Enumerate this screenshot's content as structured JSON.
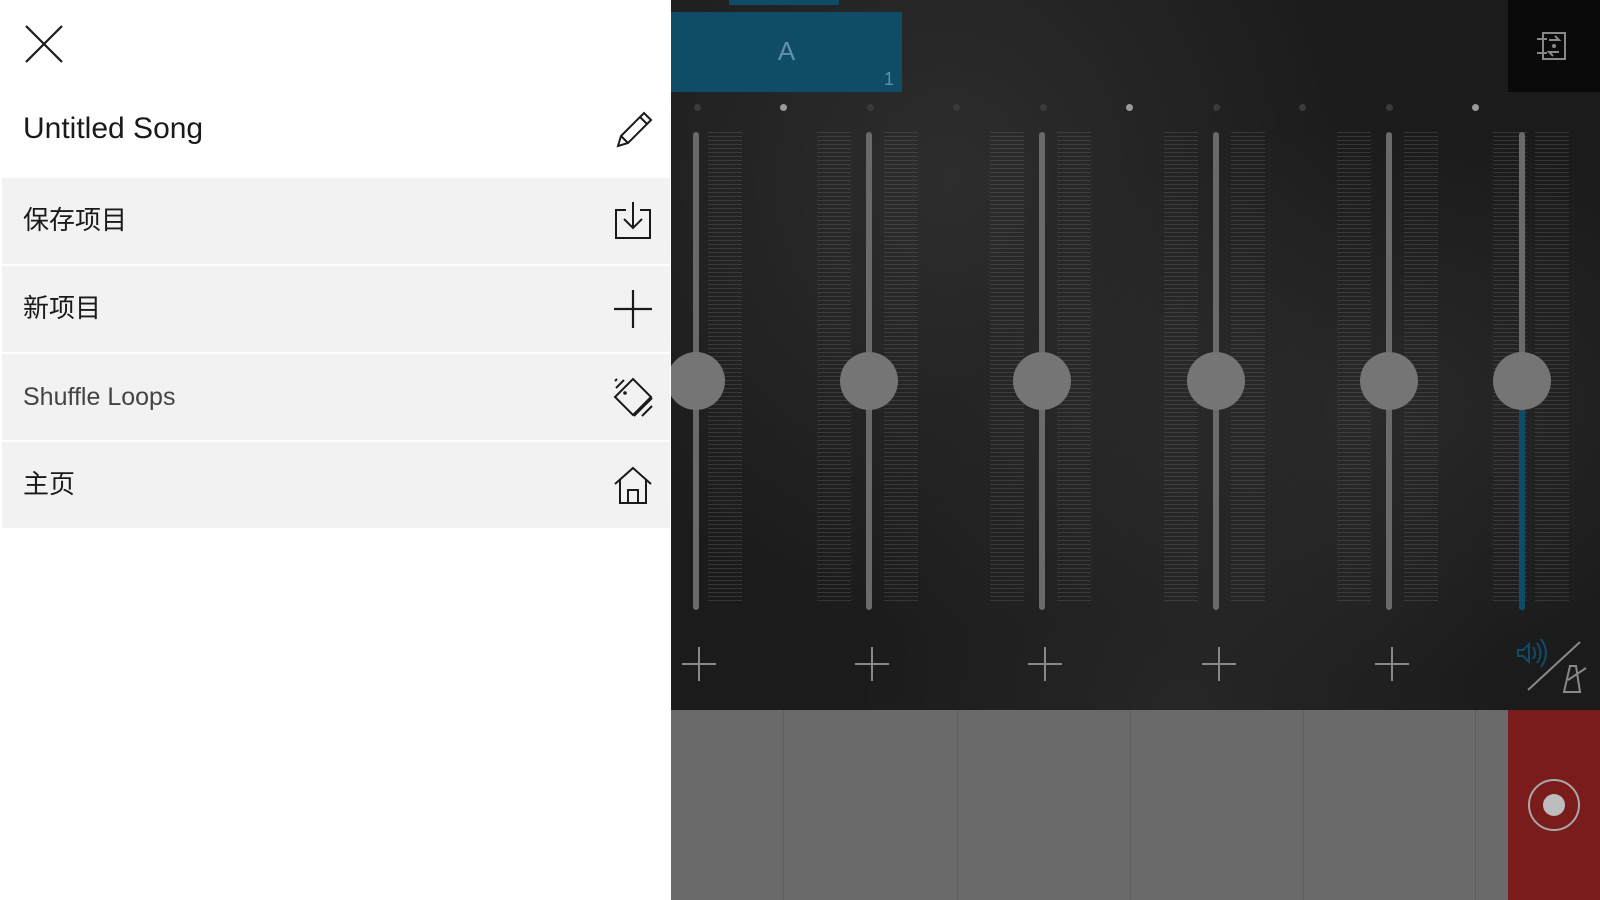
{
  "menu": {
    "song_title": "Untitled Song",
    "items": [
      {
        "label": "保存项目",
        "icon": "save-download-icon"
      },
      {
        "label": "新项目",
        "icon": "plus-icon"
      },
      {
        "label": "Shuffle Loops",
        "icon": "shuffle-dice-icon"
      },
      {
        "label": "主页",
        "icon": "home-icon"
      }
    ]
  },
  "mixer": {
    "scene": {
      "letter": "A",
      "number": "1"
    },
    "channels": [
      {
        "level": 0.48
      },
      {
        "level": 0.48
      },
      {
        "level": 0.48
      },
      {
        "level": 0.48
      },
      {
        "level": 0.48
      },
      {
        "level": 0.48
      }
    ],
    "accent_color": "#0e4c68",
    "record_color": "#7a1c1c"
  }
}
